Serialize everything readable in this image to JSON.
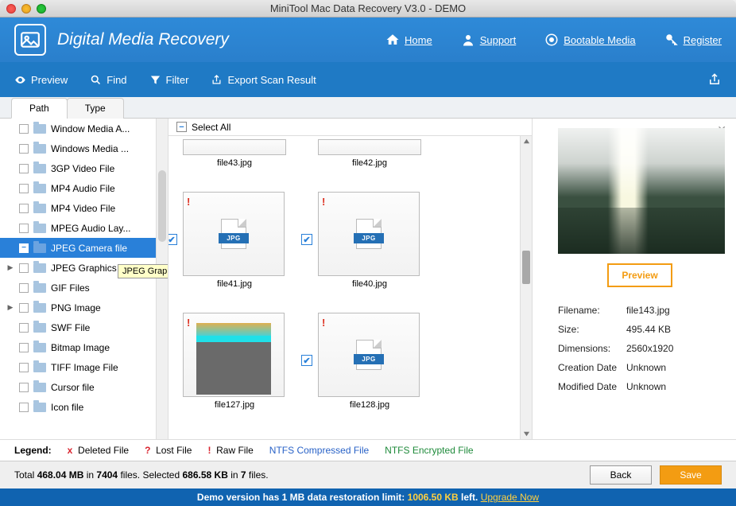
{
  "window_title": "MiniTool Mac Data Recovery V3.0 - DEMO",
  "app_name": "Digital Media Recovery",
  "nav": {
    "home": "Home",
    "support": "Support",
    "bootable": "Bootable Media",
    "register": "Register"
  },
  "toolbar": {
    "preview": "Preview",
    "find": "Find",
    "filter": "Filter",
    "export": "Export Scan Result"
  },
  "tabs": {
    "path": "Path",
    "type": "Type"
  },
  "tree": [
    {
      "label": "Window Media A..."
    },
    {
      "label": "Windows Media ..."
    },
    {
      "label": "3GP Video File"
    },
    {
      "label": "MP4 Audio File"
    },
    {
      "label": "MP4 Video File"
    },
    {
      "label": "MPEG Audio Lay..."
    },
    {
      "label": "JPEG Camera file",
      "selected": true
    },
    {
      "label": "JPEG Graphics file",
      "expand": true
    },
    {
      "label": "GIF Files"
    },
    {
      "label": "PNG Image",
      "expand": true
    },
    {
      "label": "SWF File"
    },
    {
      "label": "Bitmap Image"
    },
    {
      "label": "TIFF Image File"
    },
    {
      "label": "Cursor file"
    },
    {
      "label": "Icon file"
    }
  ],
  "tooltip": "JPEG Graphics file",
  "select_all": "Select All",
  "thumbs": {
    "r0a": "file43.jpg",
    "r0b": "file42.jpg",
    "r1a": "file41.jpg",
    "r1b": "file40.jpg",
    "r2a": "file127.jpg",
    "r2b": "file128.jpg"
  },
  "jpg_badge": "JPG",
  "preview_btn": "Preview",
  "meta": {
    "filename_k": "Filename:",
    "filename_v": "file143.jpg",
    "size_k": "Size:",
    "size_v": "495.44 KB",
    "dim_k": "Dimensions:",
    "dim_v": "2560x1920",
    "cdate_k": "Creation Date",
    "cdate_v": "Unknown",
    "mdate_k": "Modified Date",
    "mdate_v": "Unknown"
  },
  "legend": {
    "label": "Legend:",
    "deleted": "Deleted File",
    "lost": "Lost File",
    "raw": "Raw File",
    "ntfs": "NTFS Compressed File",
    "enc": "NTFS Encrypted File"
  },
  "status": {
    "total_pre": "Total ",
    "total_size": "468.04 MB",
    "in": " in ",
    "total_files": "7404",
    "files_sel": " files.  Selected ",
    "sel_size": "686.58 KB",
    "sel_in": " in ",
    "sel_n": "7",
    "sel_suf": " files.",
    "back": "Back",
    "save": "Save"
  },
  "footer": {
    "pre": "Demo version has 1 MB data restoration limit: ",
    "limit": "1006.50 KB",
    "left": " left. ",
    "upgrade": "Upgrade Now"
  }
}
